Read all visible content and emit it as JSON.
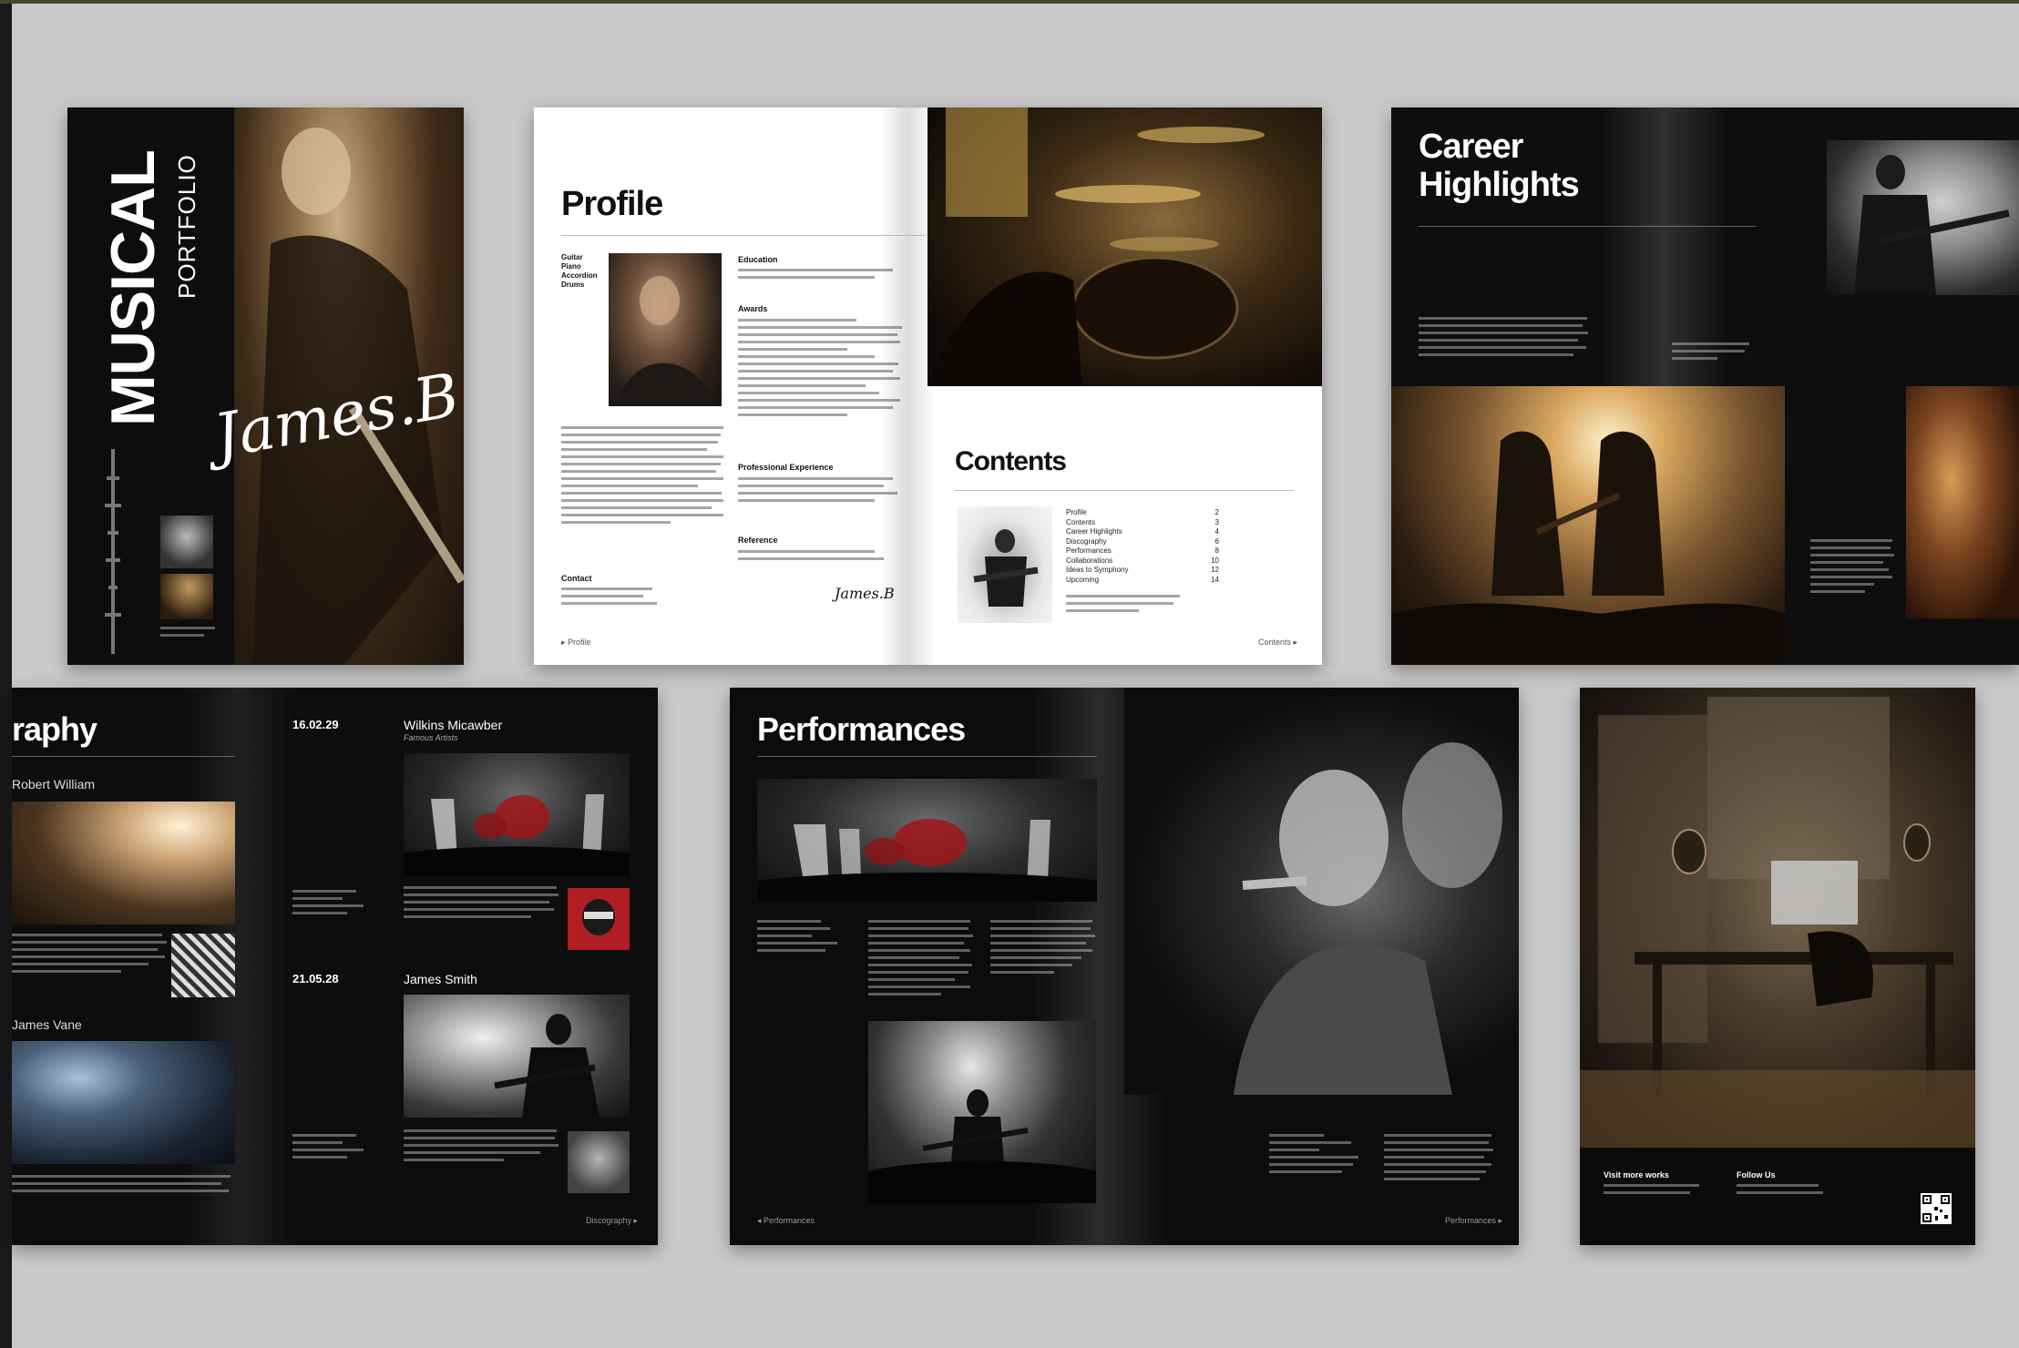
{
  "cover": {
    "title_vertical": "MUSICAL",
    "subtitle_vertical": "PORTFOLIO",
    "signature": "James.B"
  },
  "profile": {
    "title": "Profile",
    "instruments": [
      "Guitar",
      "Piano",
      "Accordion",
      "Drums"
    ],
    "education_heading": "Education",
    "awards_heading": "Awards",
    "experience_heading": "Professional Experience",
    "reference_heading": "Reference",
    "contact_heading": "Contact",
    "signature": "James.B",
    "footer_left": "Profile",
    "contents_title": "Contents",
    "contents_items": [
      "Profile",
      "Contents",
      "Career Highlights",
      "Discography",
      "Performances",
      "Collaborations",
      "Ideas to Symphony",
      "Upcoming"
    ],
    "contents_pages": [
      "2",
      "3",
      "4",
      "6",
      "8",
      "10",
      "12",
      "14"
    ],
    "footer_right": "Contents"
  },
  "career": {
    "title_line1": "Career",
    "title_line2": "Highlights"
  },
  "discography": {
    "title_partial": "raphy",
    "artist1": "Robert William",
    "artist2": "James Vane",
    "date1": "16.02.29",
    "name1": "Wilkins Micawber",
    "sub1": "Famous Artists",
    "date2": "21.05.28",
    "name2": "James Smith",
    "footer": "Discography"
  },
  "performances": {
    "title": "Performances",
    "footer_left": "Performances",
    "footer_right": "Performances"
  },
  "studio": {
    "visit_label": "Visit more works",
    "follow_label": "Follow Us"
  }
}
